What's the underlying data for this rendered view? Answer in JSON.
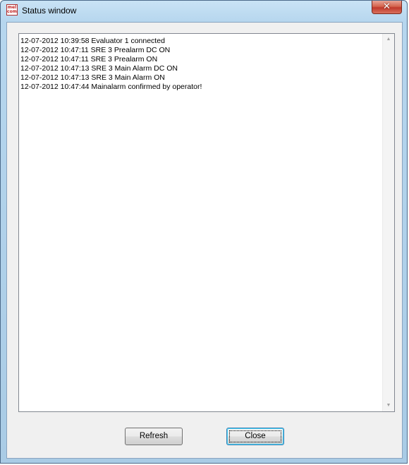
{
  "window": {
    "title": "Status window",
    "app_icon_text_top": "mel",
    "app_icon_text_bottom": "com",
    "close_glyph": "✕"
  },
  "log": {
    "lines": [
      "12-07-2012 10:39:58 Evaluator 1 connected",
      "12-07-2012 10:47:11 SRE 3 Prealarm DC ON",
      "12-07-2012 10:47:11 SRE 3 Prealarm ON",
      "12-07-2012 10:47:13 SRE 3 Main Alarm DC ON",
      "12-07-2012 10:47:13 SRE 3 Main Alarm ON",
      "12-07-2012 10:47:44 Mainalarm confirmed by operator!"
    ],
    "scroll_up_glyph": "▲",
    "scroll_down_glyph": "▼"
  },
  "buttons": {
    "refresh_label": "Refresh",
    "close_label": "Close"
  },
  "colors": {
    "title_frame": "#b6d6ee",
    "close_button": "#c0392b",
    "client_background": "#f0f0f0",
    "focused_button_border": "#3c7fb1"
  }
}
